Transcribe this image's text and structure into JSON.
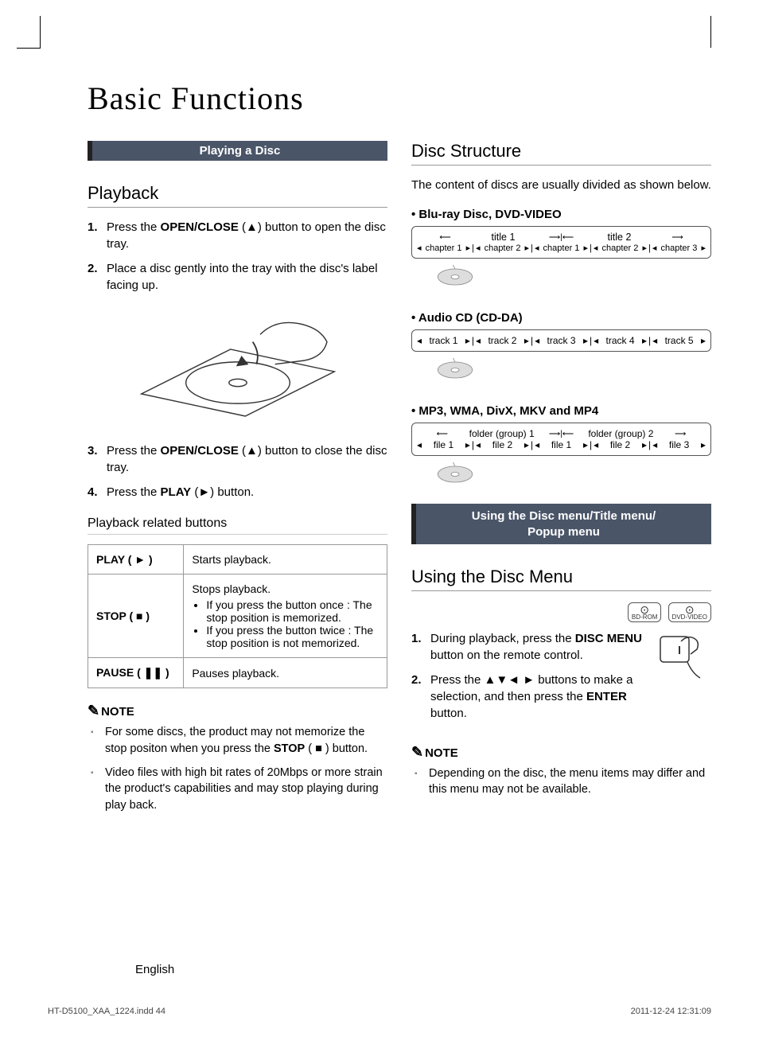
{
  "title": "Basic Functions",
  "left": {
    "section_bar": "Playing a Disc",
    "playback_heading": "Playback",
    "steps": {
      "s1a": "Press the ",
      "s1b": "OPEN/CLOSE",
      "s1c": " (▲) button to open the disc tray.",
      "s2": "Place a disc gently into the tray with the disc's label facing up.",
      "s3a": "Press the ",
      "s3b": "OPEN/CLOSE",
      "s3c": " (▲) button to close the disc tray.",
      "s4a": "Press the ",
      "s4b": "PLAY",
      "s4c": " (►) button."
    },
    "related_heading": "Playback related buttons",
    "table": {
      "play_label": "PLAY ( ► )",
      "play_desc": "Starts playback.",
      "stop_label": "STOP ( ■ )",
      "stop_desc_head": "Stops playback.",
      "stop_b1": "If you press the button once : The stop position is memorized.",
      "stop_b2": "If you press the button twice : The stop position is not memorized.",
      "pause_label": "PAUSE ( ❚❚ )",
      "pause_desc": "Pauses playback."
    },
    "note_label": "NOTE",
    "notes": {
      "n1a": "For some discs, the product may not memorize the stop positon when you press the ",
      "n1b": "STOP",
      "n1c": " ( ■ ) button.",
      "n2": "Video files with high bit rates of 20Mbps or more strain the product's capabilities and may stop playing during play back."
    }
  },
  "right": {
    "disc_struct_heading": "Disc Structure",
    "disc_struct_intro": "The content of discs are usually divided as shown below.",
    "bluray_label": "Blu-ray Disc, DVD-VIDEO",
    "bluray": {
      "title1": "title 1",
      "title2": "title 2",
      "c1": "chapter 1",
      "c2": "chapter 2",
      "c3": "chapter 1",
      "c4": "chapter 2",
      "c5": "chapter 3"
    },
    "audio_label": "Audio CD (CD-DA)",
    "audio": {
      "t1": "track 1",
      "t2": "track 2",
      "t3": "track 3",
      "t4": "track 4",
      "t5": "track 5"
    },
    "files_label": "MP3, WMA, DivX, MKV and MP4",
    "files": {
      "g1": "folder (group) 1",
      "g2": "folder (group) 2",
      "f1": "file 1",
      "f2": "file 2",
      "f3": "file 1",
      "f4": "file 2",
      "f5": "file 3"
    },
    "section_bar2": "Using the Disc menu/Title menu/\nPopup menu",
    "using_heading": "Using the Disc Menu",
    "badge1": "BD-ROM",
    "badge2": "DVD-VIDEO",
    "steps2": {
      "s1a": "During playback, press the ",
      "s1b": "DISC MENU",
      "s1c": "  button on the remote control.",
      "s2a": "Press the ▲▼◄ ► buttons to make a selection, and then press the ",
      "s2b": "ENTER",
      "s2c": " button."
    },
    "note_label": "NOTE",
    "note2": "Depending on the disc, the menu items may differ and this menu may not be available."
  },
  "footer_lang": "English",
  "meta_left": "HT-D5100_XAA_1224.indd   44",
  "meta_right": "2011-12-24   12:31:09"
}
